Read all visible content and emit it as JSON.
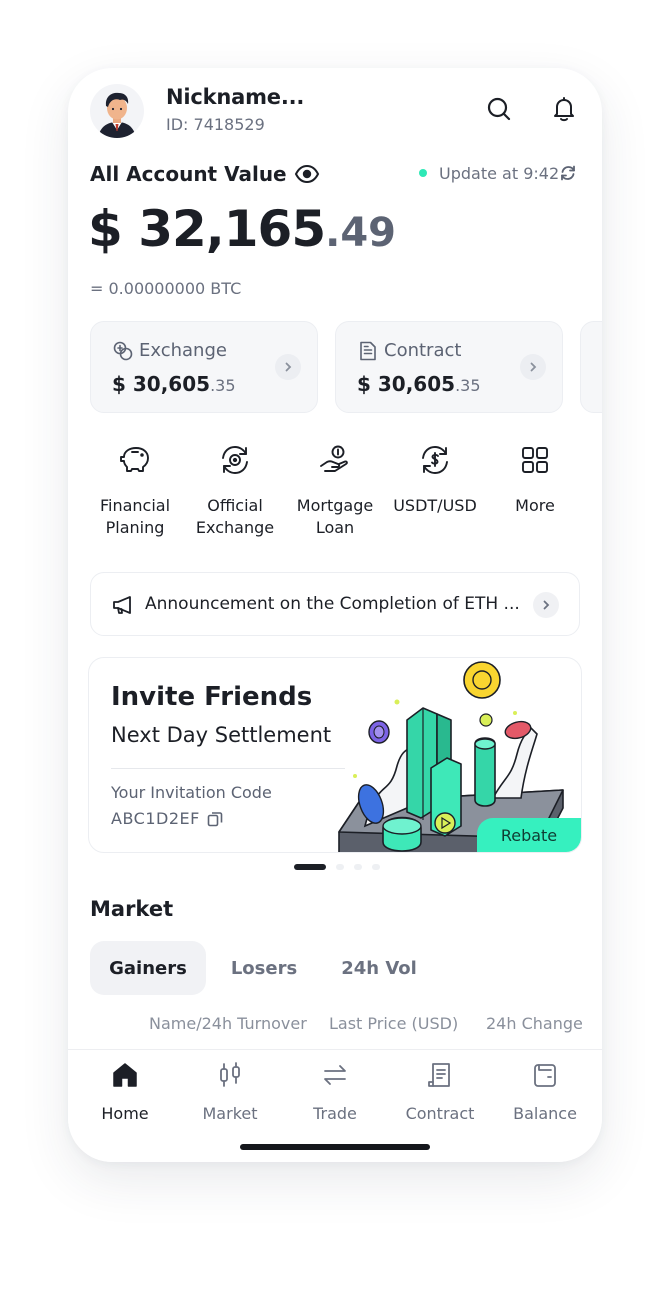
{
  "header": {
    "nickname": "Nickname...",
    "user_id": "ID: 7418529",
    "icons": [
      "search-icon",
      "bell-icon"
    ]
  },
  "account": {
    "title": "All Account Value",
    "update_text": "Update at 9:42",
    "value_main": "$ 32,165",
    "value_decimal": ".49",
    "btc_value": "= 0.00000000 BTC",
    "accent": "#2ee8b6"
  },
  "cards": [
    {
      "label": "Exchange",
      "value_main": "$ 30,605",
      "value_decimal": ".35",
      "icon": "exchange-coins-icon"
    },
    {
      "label": "Contract",
      "value_main": "$ 30,605",
      "value_decimal": ".35",
      "icon": "document-icon"
    }
  ],
  "quick_actions": [
    {
      "line1": "Financial",
      "line2": "Planing",
      "icon": "piggy-bank-icon"
    },
    {
      "line1": "Official",
      "line2": "Exchange",
      "icon": "exchange-cycle-icon"
    },
    {
      "line1": "Mortgage",
      "line2": "Loan",
      "icon": "hand-coin-icon"
    },
    {
      "line1": "USDT/USD",
      "line2": "",
      "icon": "dollar-cycle-icon"
    },
    {
      "line1": "More",
      "line2": "",
      "icon": "grid-icon"
    }
  ],
  "announcement": {
    "text": "Announcement on the Completion of ETH ..."
  },
  "banner": {
    "title": "Invite Friends",
    "subtitle": "Next Day Settlement",
    "code_label": "Your Invitation Code",
    "code": "ABC1D2EF",
    "badge": "Rebate",
    "badge_color": "#36f0bf",
    "page_count": 4,
    "active_page": 1
  },
  "market": {
    "title": "Market",
    "tabs": [
      "Gainers",
      "Losers",
      "24h Vol"
    ],
    "active_tab": "Gainers",
    "columns": [
      "Name/24h Turnover",
      "Last Price (USD)",
      "24h Change"
    ]
  },
  "nav": {
    "items": [
      "Home",
      "Market",
      "Trade",
      "Contract",
      "Balance"
    ],
    "active": "Home"
  }
}
